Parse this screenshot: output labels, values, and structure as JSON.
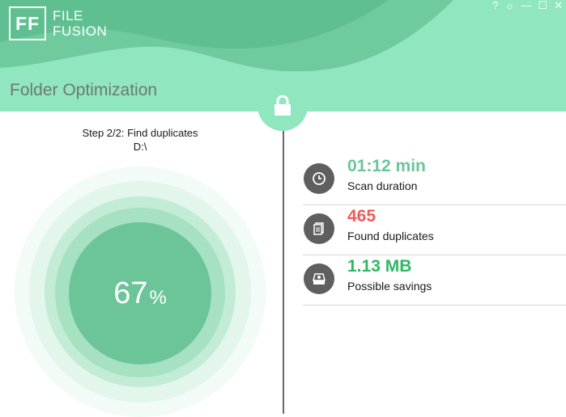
{
  "app": {
    "logo_mark": "FF",
    "logo_line1": "FILE",
    "logo_line2": "FUSION",
    "brand_color": "#90e6be",
    "accent_color": "#6cc599"
  },
  "window_controls": {
    "help": "?",
    "settings": "☼",
    "minimize": "—",
    "maximize": "☐",
    "close": "✕"
  },
  "header": {
    "title": "Folder Optimization",
    "lock_icon": "lock-icon"
  },
  "progress": {
    "step": "Step 2/2: Find duplicates",
    "path": "D:\\",
    "percent_value": "67",
    "percent_symbol": "%"
  },
  "stats": [
    {
      "icon": "clock-icon",
      "value": "01:12 min",
      "label": "Scan duration",
      "color": "#6cc599"
    },
    {
      "icon": "files-icon",
      "value": "465",
      "label": "Found duplicates",
      "color": "#ef5b5b"
    },
    {
      "icon": "drive-icon",
      "value": "1.13 MB",
      "label": "Possible savings",
      "color": "#2eb865"
    }
  ]
}
